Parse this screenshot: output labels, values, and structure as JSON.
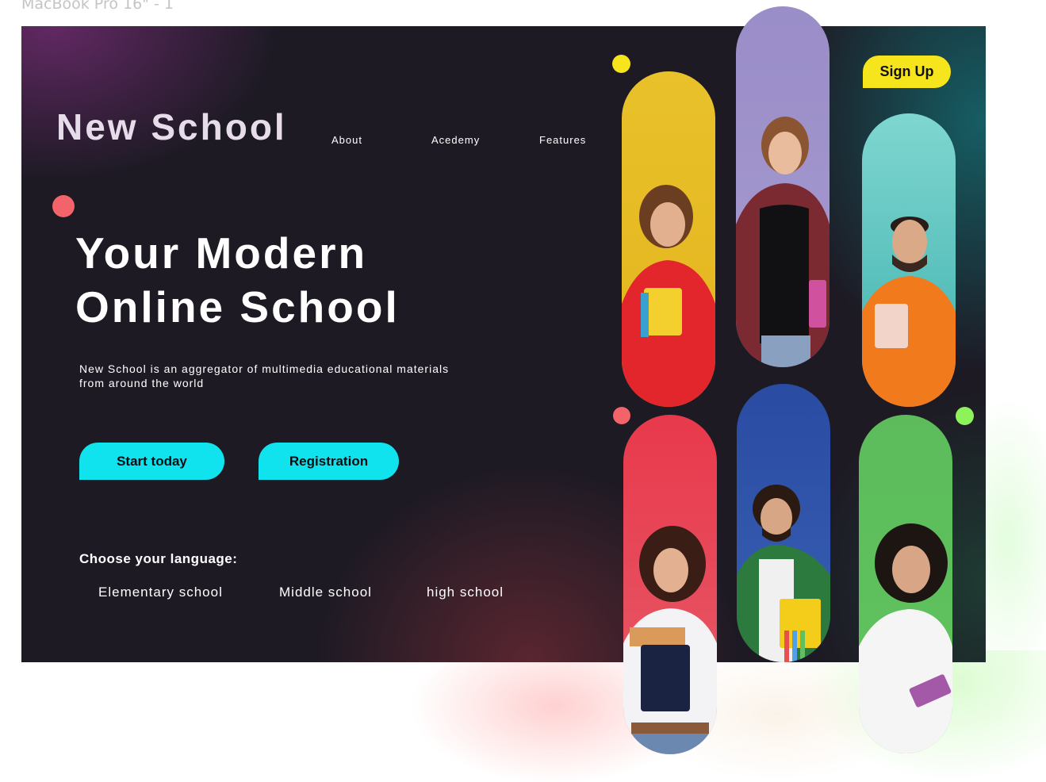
{
  "canvas": {
    "frame_label": "MacBook Pro 16\" - 1"
  },
  "brand": {
    "name": "New School"
  },
  "nav": {
    "items": [
      {
        "label": "About"
      },
      {
        "label": "Acedemy"
      },
      {
        "label": "Features"
      }
    ]
  },
  "header": {
    "signup_label": "Sign Up"
  },
  "hero": {
    "headline_line1": "Your Modern",
    "headline_line2": "Online School",
    "subtitle": "New School is an aggregator of multimedia educational materials from around the world",
    "primary_button": "Start today",
    "secondary_button": "Registration"
  },
  "language": {
    "title": "Choose your language:",
    "options": [
      {
        "label": "Elementary school"
      },
      {
        "label": "Middle school"
      },
      {
        "label": "high school"
      }
    ]
  },
  "colors": {
    "background": "#1d1a24",
    "accent_cyan": "#10e3ee",
    "accent_yellow": "#f6e51d",
    "dot_coral": "#f2636a",
    "dot_green": "#8ef25a",
    "pill_yellow": "#e9c12a",
    "pill_lavender": "#9d8fc6",
    "pill_teal": "#73cfc9",
    "pill_red": "#e44a59",
    "pill_blue": "#2e4fa0",
    "pill_green": "#5cbe58"
  },
  "student_photos": [
    {
      "description_icon": "student-photo-icon",
      "color_key": "pill_yellow"
    },
    {
      "description_icon": "student-photo-icon",
      "color_key": "pill_lavender"
    },
    {
      "description_icon": "student-photo-icon",
      "color_key": "pill_teal"
    },
    {
      "description_icon": "student-photo-icon",
      "color_key": "pill_red"
    },
    {
      "description_icon": "student-photo-icon",
      "color_key": "pill_blue"
    },
    {
      "description_icon": "student-photo-icon",
      "color_key": "pill_green"
    }
  ]
}
